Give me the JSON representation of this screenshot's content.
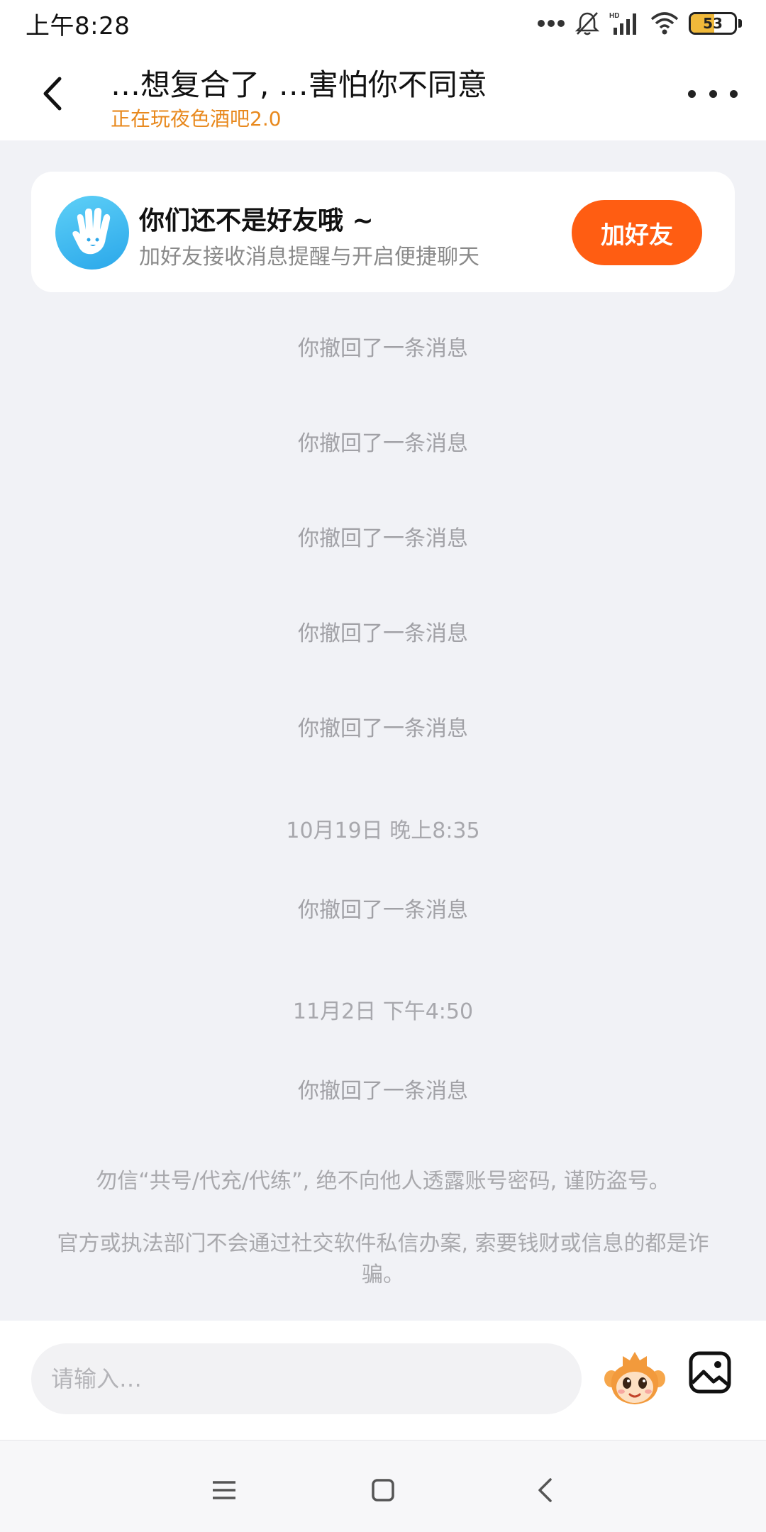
{
  "status_bar": {
    "time": "上午8:28",
    "battery": "53",
    "icons": [
      "more-dots-icon",
      "bell-muted-icon",
      "hd-signal-icon",
      "wifi-icon",
      "battery-icon"
    ]
  },
  "header": {
    "title": "…想复合了, …害怕你不同意",
    "subtitle": "正在玩夜色酒吧2.0",
    "back_icon": "chevron-left-icon",
    "more_icon": "more-horizontal-icon"
  },
  "friend_card": {
    "title": "你们还不是好友哦 ~",
    "description": "加好友接收消息提醒与开启便捷聊天",
    "button_label": "加好友",
    "avatar_icon": "hand-wave-icon"
  },
  "messages": [
    {
      "type": "recall",
      "text": "你撤回了一条消息"
    },
    {
      "type": "recall",
      "text": "你撤回了一条消息"
    },
    {
      "type": "recall",
      "text": "你撤回了一条消息"
    },
    {
      "type": "recall",
      "text": "你撤回了一条消息"
    },
    {
      "type": "recall",
      "text": "你撤回了一条消息"
    },
    {
      "type": "timestamp",
      "text": "10月19日 晚上8:35"
    },
    {
      "type": "recall",
      "text": "你撤回了一条消息"
    },
    {
      "type": "timestamp",
      "text": "11月2日 下午4:50"
    },
    {
      "type": "recall",
      "text": "你撤回了一条消息"
    }
  ],
  "notices": [
    "勿信“共号/代充/代练”, 绝不向他人透露账号密码, 谨防盗号。",
    "官方或执法部门不会通过社交软件私信办案, 索要钱财或信息的都是诈骗。"
  ],
  "input": {
    "placeholder": "请输入…",
    "emoji_icon": "monkey-emoji-icon",
    "image_icon": "image-picture-icon"
  },
  "nav": {
    "icons": [
      "menu-icon",
      "home-square-icon",
      "back-chevron-icon"
    ]
  },
  "colors": {
    "accent": "#ff5d12",
    "subtitle": "#e8891e",
    "background": "#f1f2f6",
    "system_text": "#a1a1a6"
  }
}
